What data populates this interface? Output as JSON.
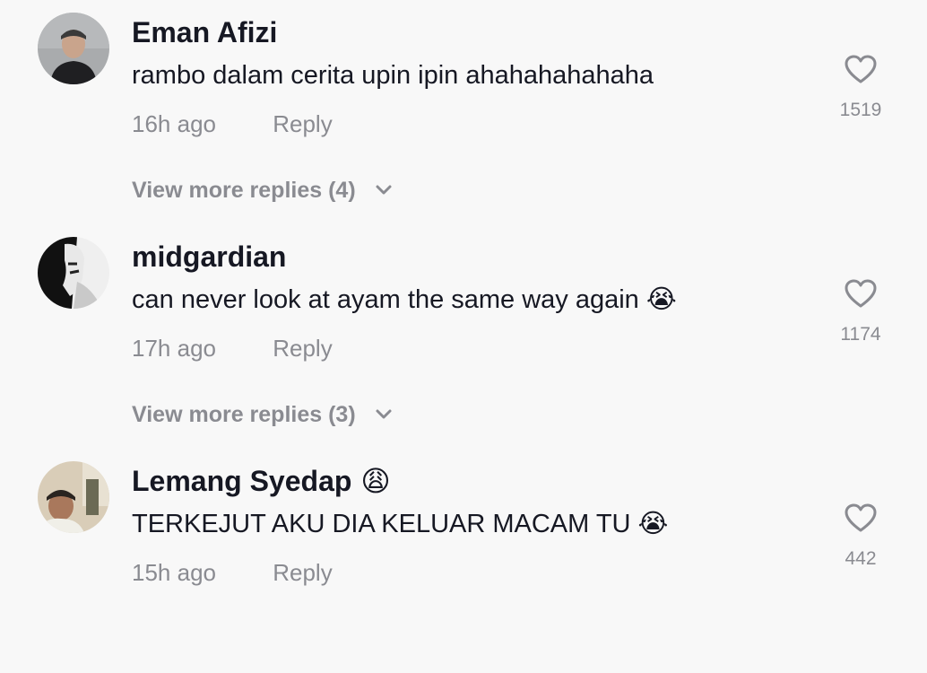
{
  "comments": [
    {
      "username": "Eman Afizi",
      "username_emoji": "",
      "text": "rambo dalam cerita upin ipin ahahahahahaha",
      "text_emoji": "",
      "time": "16h ago",
      "reply_label": "Reply",
      "likes": "1519",
      "view_more": "View more replies (4)"
    },
    {
      "username": "midgardian",
      "username_emoji": "",
      "text": "can never look at ayam the same way again",
      "text_emoji": "😭",
      "time": "17h ago",
      "reply_label": "Reply",
      "likes": "1174",
      "view_more": "View more replies (3)"
    },
    {
      "username": "Lemang Syedap",
      "username_emoji": "😩",
      "text": "TERKEJUT AKU DIA KELUAR MACAM TU",
      "text_emoji": "😭",
      "time": "15h ago",
      "reply_label": "Reply",
      "likes": "442"
    }
  ],
  "icons": {
    "like": "heart-outline-icon",
    "expand": "chevron-down-icon"
  },
  "colors": {
    "background": "#f8f8f8",
    "primary_text": "#161823",
    "secondary_text": "#8a8b91"
  }
}
